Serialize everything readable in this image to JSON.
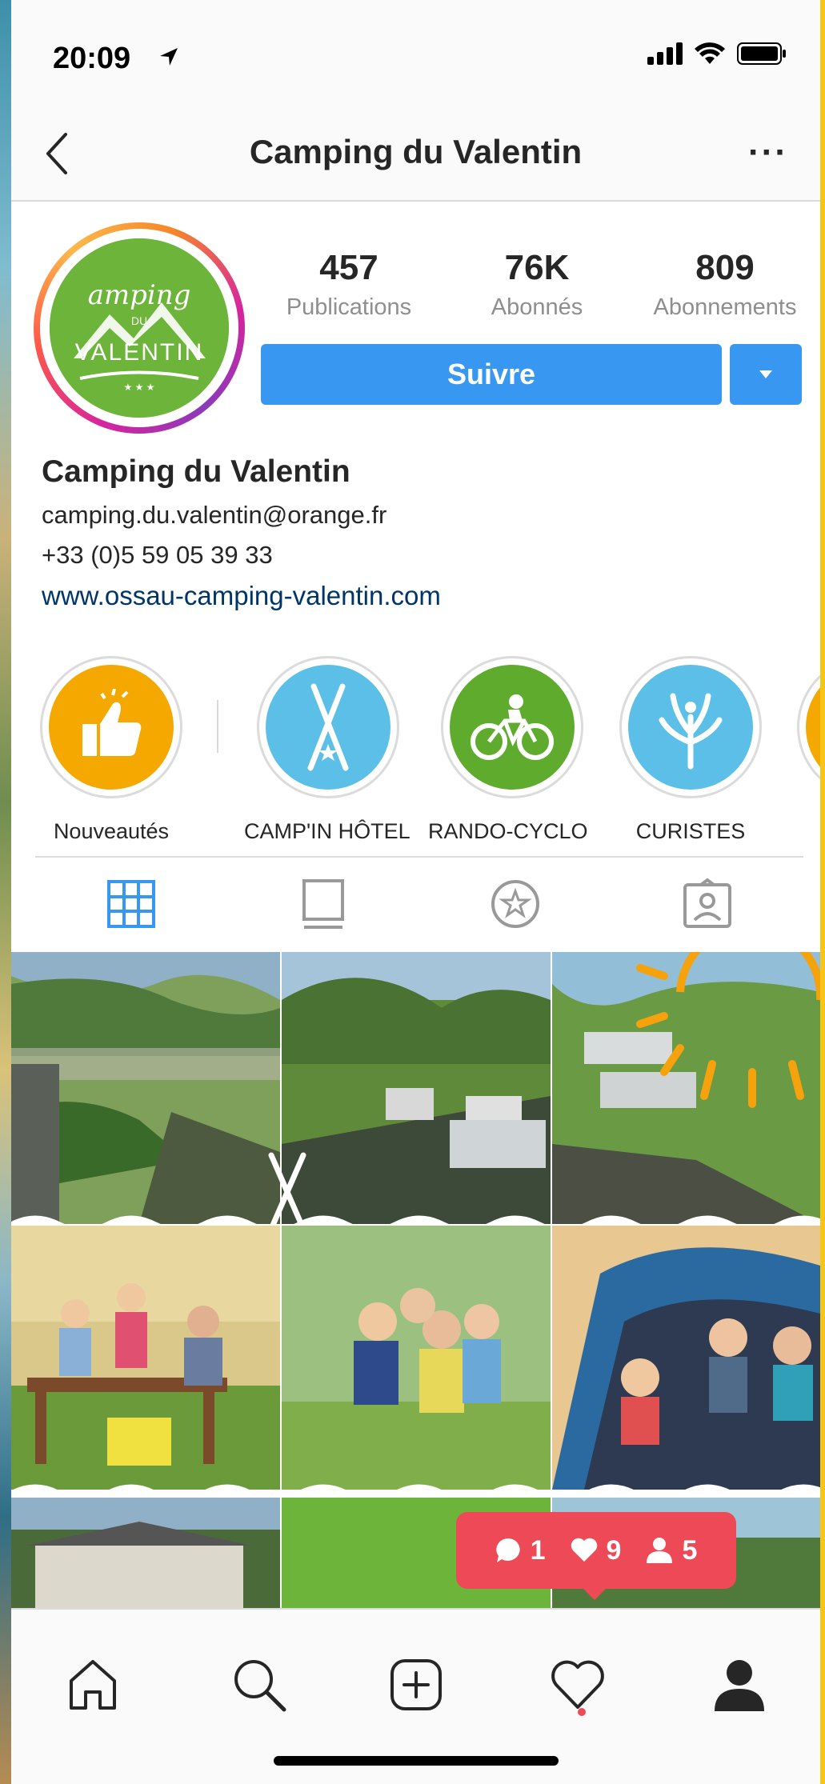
{
  "status_bar": {
    "time": "20:09"
  },
  "nav": {
    "title": "Camping du Valentin",
    "more_label": "···"
  },
  "avatar": {
    "logo_line1": "amping",
    "logo_line2": "DU",
    "logo_line3": "VALENTIN"
  },
  "stats": [
    {
      "value": "457",
      "label": "Publications"
    },
    {
      "value": "76K",
      "label": "Abonnés"
    },
    {
      "value": "809",
      "label": "Abonnements"
    }
  ],
  "follow_button": {
    "label": "Suivre"
  },
  "bio": {
    "name": "Camping du Valentin",
    "email": "camping.du.valentin@orange.fr",
    "phone": "+33 (0)5 59 05 39 33",
    "website": "www.ossau-camping-valentin.com"
  },
  "highlights": [
    {
      "label": "Nouveautés",
      "color": "#f5a800"
    },
    {
      "label": "CAMP'IN HÔTEL",
      "color": "#5bbfe8"
    },
    {
      "label": "RANDO-CYCLO",
      "color": "#5fab2e"
    },
    {
      "label": "CURISTES",
      "color": "#5bbfe8"
    },
    {
      "label": "",
      "color": "#f5a800"
    }
  ],
  "notification": {
    "comments": "1",
    "likes": "9",
    "followers": "5"
  },
  "colors": {
    "accent": "#3897f0",
    "notification": "#ed4956",
    "link": "#003569"
  }
}
